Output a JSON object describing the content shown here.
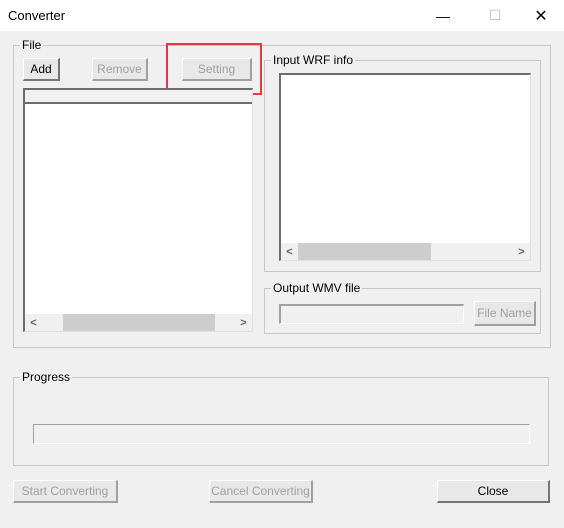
{
  "window": {
    "title": "Converter",
    "minimize_icon": "—",
    "maximize_icon": "☐",
    "close_icon": "✕"
  },
  "file_group": {
    "label": "File",
    "add_label": "Add",
    "remove_label": "Remove",
    "setting_label": "Setting",
    "scroll_left": "<",
    "scroll_right": ">"
  },
  "input_info_group": {
    "label": "Input WRF info",
    "scroll_left": "<",
    "scroll_right": ">"
  },
  "output_group": {
    "label": "Output WMV file",
    "file_value": "",
    "file_name_label": "File Name"
  },
  "progress_group": {
    "label": "Progress",
    "value_percent": 0
  },
  "footer": {
    "start_label": "Start Converting",
    "cancel_label": "Cancel Converting",
    "close_label": "Close"
  },
  "annotation": {
    "highlight_color": "#e8383d"
  }
}
